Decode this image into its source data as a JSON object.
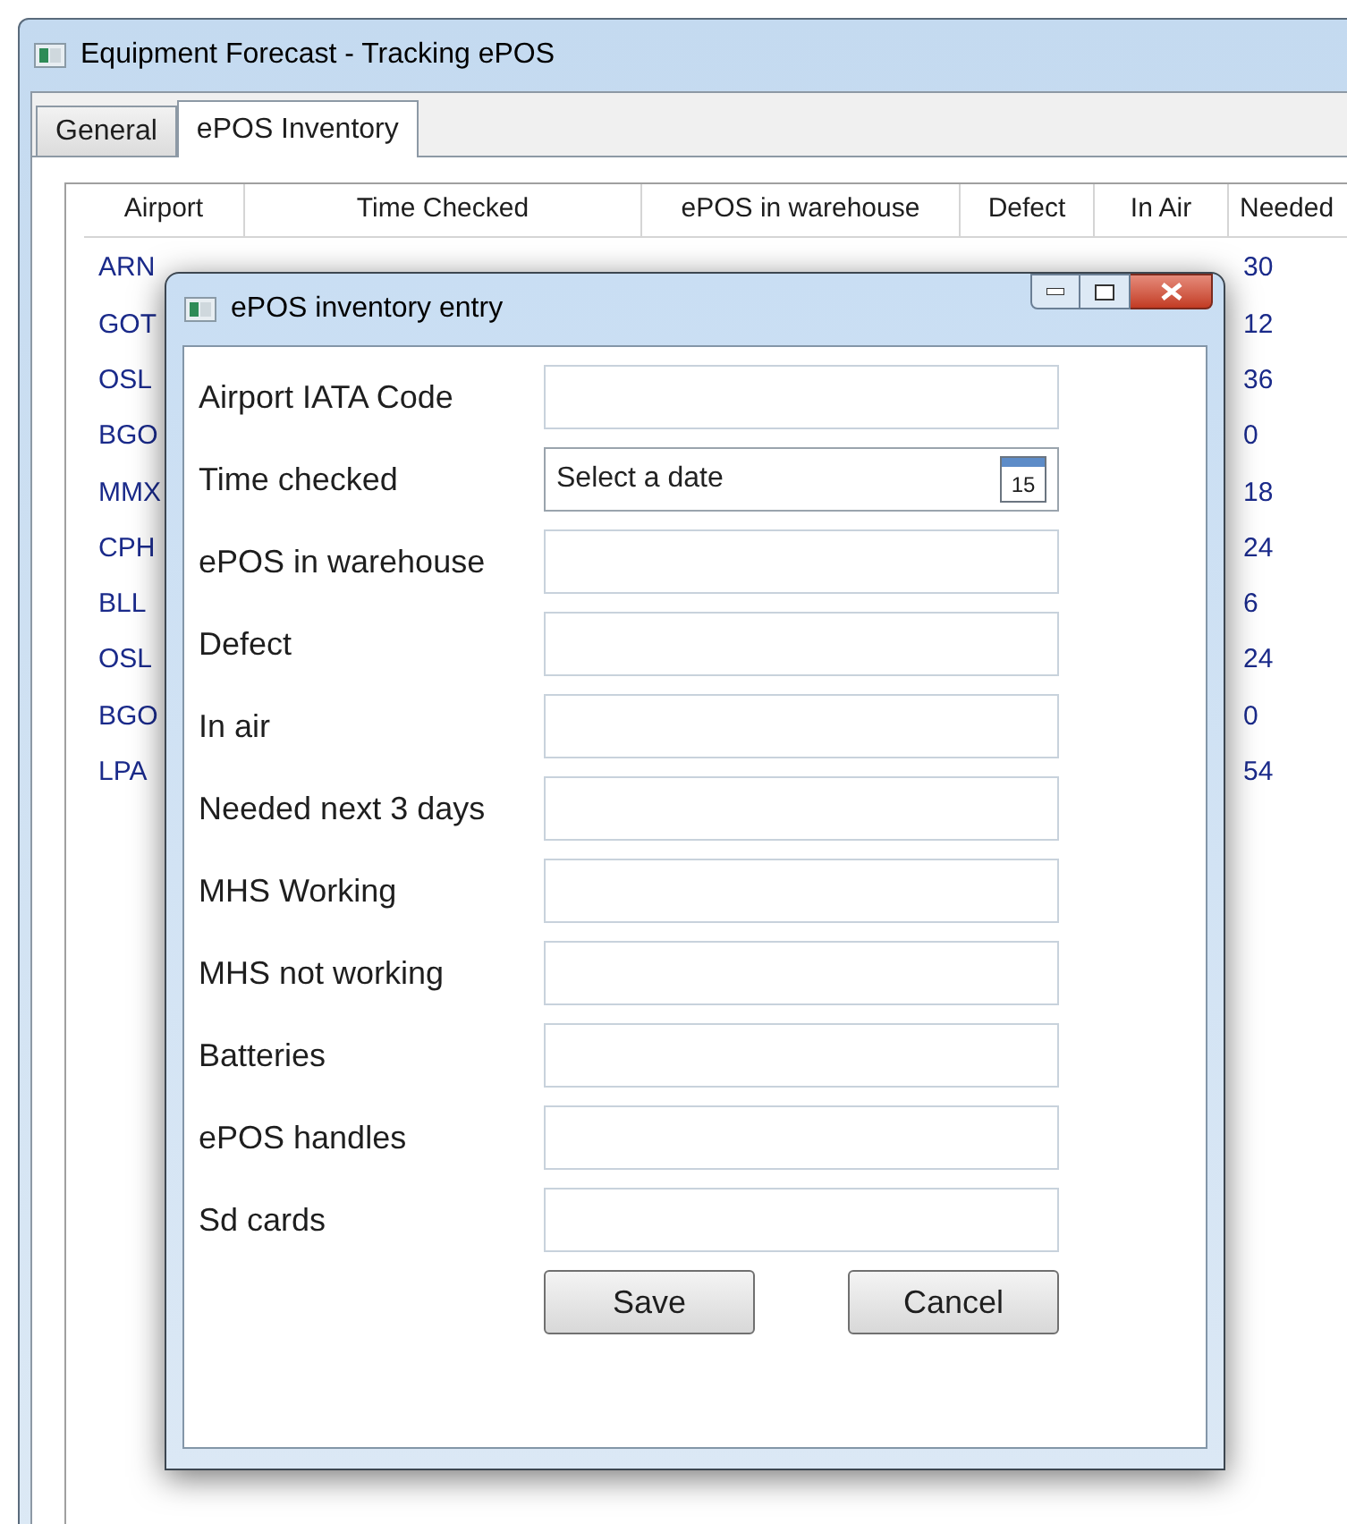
{
  "window": {
    "title": "Equipment Forecast - Tracking ePOS"
  },
  "tabs": [
    {
      "label": "General",
      "selected": false
    },
    {
      "label": "ePOS Inventory",
      "selected": true
    }
  ],
  "table": {
    "columns": [
      "Airport",
      "Time Checked",
      "ePOS in warehouse",
      "Defect",
      "In Air",
      "Needed"
    ],
    "rows": [
      {
        "airport": "ARN",
        "needed": "30"
      },
      {
        "airport": "GOT",
        "needed": "12"
      },
      {
        "airport": "OSL",
        "needed": "36"
      },
      {
        "airport": "BGO",
        "needed": "0"
      },
      {
        "airport": "MMX",
        "needed": "18"
      },
      {
        "airport": "CPH",
        "needed": "24"
      },
      {
        "airport": "BLL",
        "needed": "6"
      },
      {
        "airport": "OSL",
        "needed": "24"
      },
      {
        "airport": "BGO",
        "needed": "0"
      },
      {
        "airport": "LPA",
        "needed": "54"
      }
    ]
  },
  "dialog": {
    "title": "ePOS inventory entry",
    "fields": [
      {
        "label": "Airport IATA Code",
        "kind": "text"
      },
      {
        "label": "Time checked",
        "kind": "date",
        "placeholder": "Select a date",
        "icon_text": "15"
      },
      {
        "label": "ePOS in warehouse",
        "kind": "text"
      },
      {
        "label": "Defect",
        "kind": "text"
      },
      {
        "label": "In air",
        "kind": "text"
      },
      {
        "label": "Needed next 3 days",
        "kind": "text"
      },
      {
        "label": "MHS Working",
        "kind": "text"
      },
      {
        "label": "MHS not working",
        "kind": "text"
      },
      {
        "label": "Batteries",
        "kind": "text"
      },
      {
        "label": "ePOS handles",
        "kind": "text"
      },
      {
        "label": "Sd cards",
        "kind": "text"
      }
    ],
    "buttons": [
      "Save",
      "Cancel"
    ]
  }
}
